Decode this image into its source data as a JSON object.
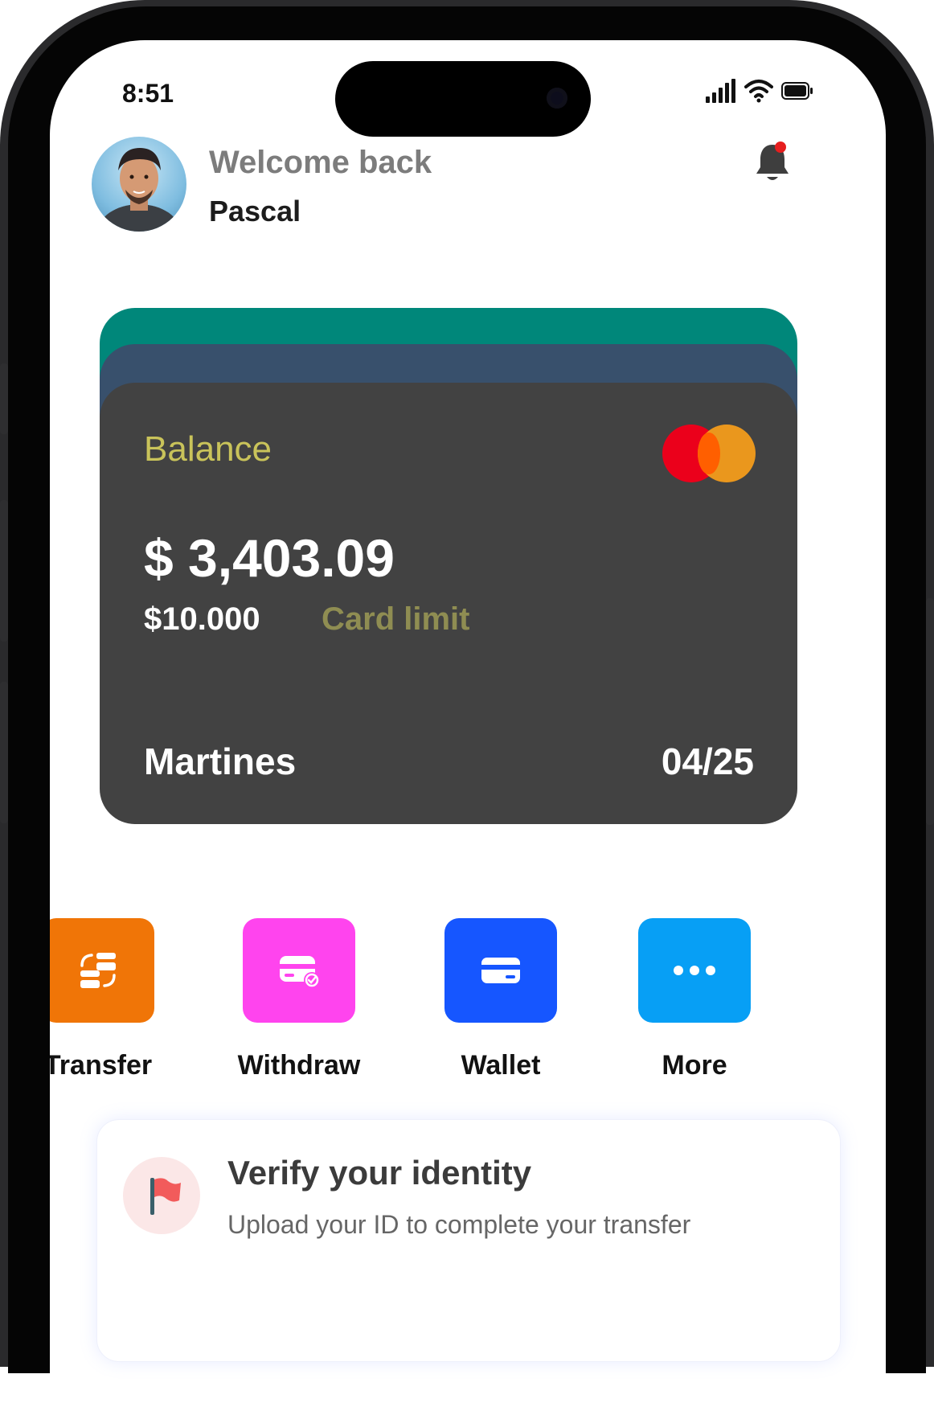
{
  "status_bar": {
    "time": "8:51",
    "icons": [
      "signal-icon",
      "wifi-icon",
      "battery-icon"
    ]
  },
  "header": {
    "greeting": "Welcome back",
    "user_name": "Pascal",
    "notification_icon": "bell-icon",
    "has_unread": true
  },
  "card": {
    "balance_label": "Balance",
    "balance": "$ 3,403.09",
    "limit_amount": "$10.000",
    "limit_label": "Card limit",
    "holder": "Martines",
    "expiry": "04/25",
    "network_logo": "mastercard-logo",
    "colors": {
      "front": "#424242",
      "back_1": "#00877A",
      "back_2": "#38506C",
      "balance_label": "#C9C35A"
    }
  },
  "actions": [
    {
      "label": "Transfer",
      "icon": "transfer-icon",
      "color": "#F07507"
    },
    {
      "label": "Withdraw",
      "icon": "withdraw-card-icon",
      "color": "#FF44EE"
    },
    {
      "label": "Wallet",
      "icon": "wallet-card-icon",
      "color": "#1656FF"
    },
    {
      "label": "More",
      "icon": "more-dots-icon",
      "color": "#079FF5"
    }
  ],
  "verify": {
    "icon": "flag-icon",
    "title": "Verify your identity",
    "subtitle": "Upload your ID to complete your transfer"
  }
}
